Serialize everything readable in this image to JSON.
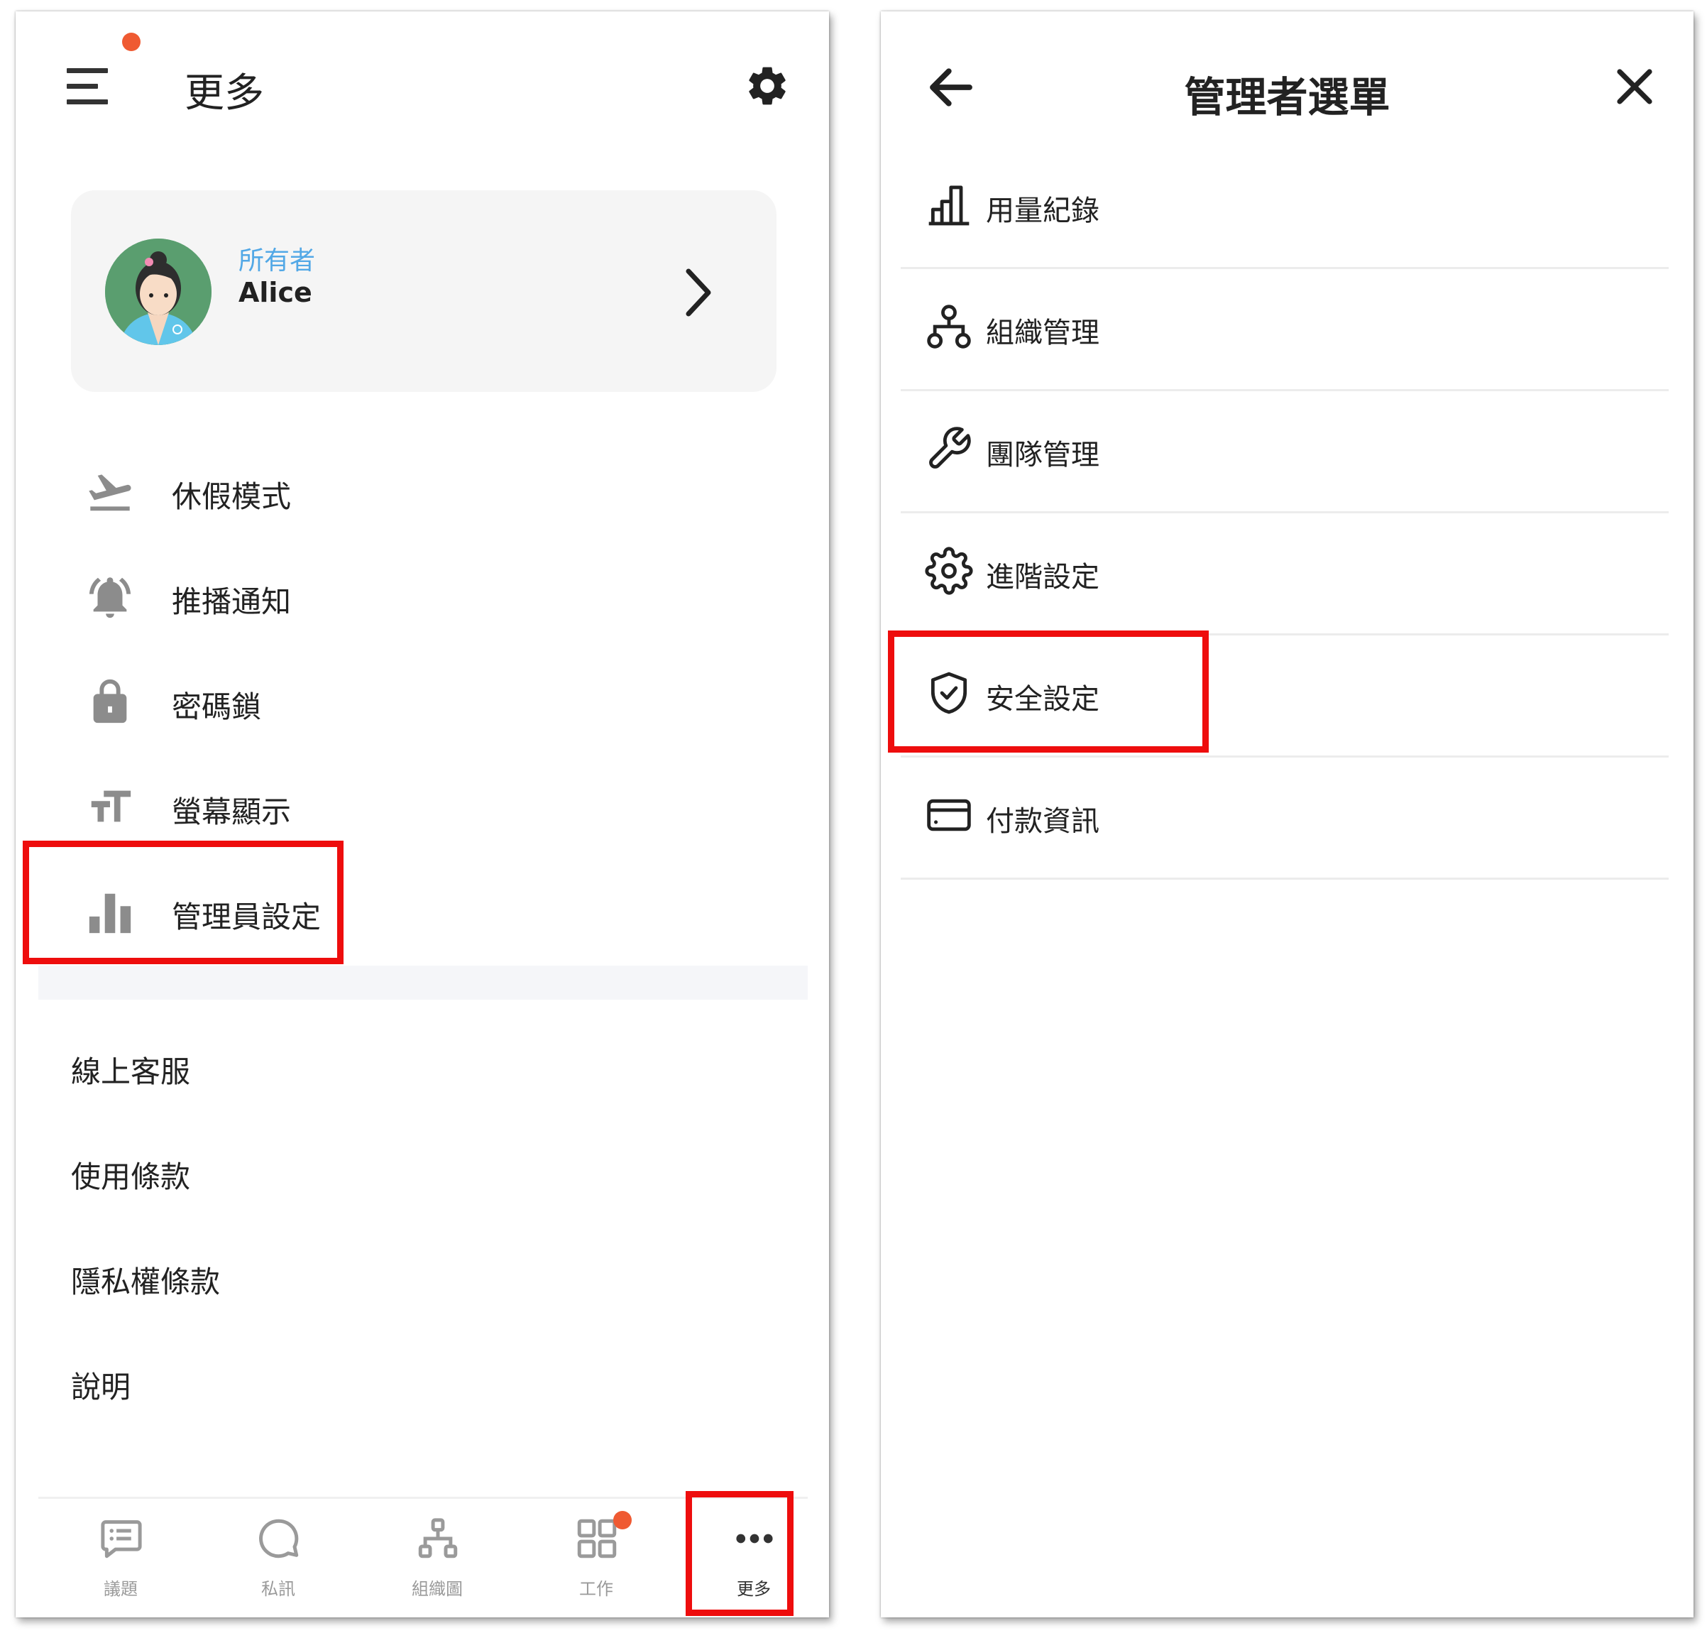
{
  "more_screen": {
    "title": "更多",
    "profile": {
      "role": "所有者",
      "name": "Alice"
    },
    "menu": [
      {
        "label": "休假模式",
        "icon": "airplane-takeoff-icon"
      },
      {
        "label": "推播通知",
        "icon": "bell-icon"
      },
      {
        "label": "密碼鎖",
        "icon": "lock-icon"
      },
      {
        "label": "螢幕顯示",
        "icon": "text-size-icon"
      },
      {
        "label": "管理員設定",
        "icon": "bar-chart-icon"
      }
    ],
    "links": [
      "線上客服",
      "使用條款",
      "隱私權條款",
      "說明"
    ],
    "tabs": [
      {
        "label": "議題",
        "icon": "chat-list-icon"
      },
      {
        "label": "私訊",
        "icon": "message-bubble-icon"
      },
      {
        "label": "組織圖",
        "icon": "org-chart-icon"
      },
      {
        "label": "工作",
        "icon": "grid-icon"
      },
      {
        "label": "更多",
        "icon": "more-dots-icon"
      }
    ]
  },
  "admin_menu": {
    "title": "管理者選單",
    "items": [
      {
        "label": "用量紀錄",
        "icon": "usage-chart-icon"
      },
      {
        "label": "組織管理",
        "icon": "org-structure-icon"
      },
      {
        "label": "團隊管理",
        "icon": "wrench-icon"
      },
      {
        "label": "進階設定",
        "icon": "gear-icon"
      },
      {
        "label": "安全設定",
        "icon": "shield-check-icon"
      },
      {
        "label": "付款資訊",
        "icon": "credit-card-icon"
      }
    ]
  },
  "colors": {
    "highlight": "#ee0d0d",
    "notification_dot": "#ef5a32",
    "role_text": "#52a8e6",
    "icon_gray": "#8c8c8c"
  }
}
